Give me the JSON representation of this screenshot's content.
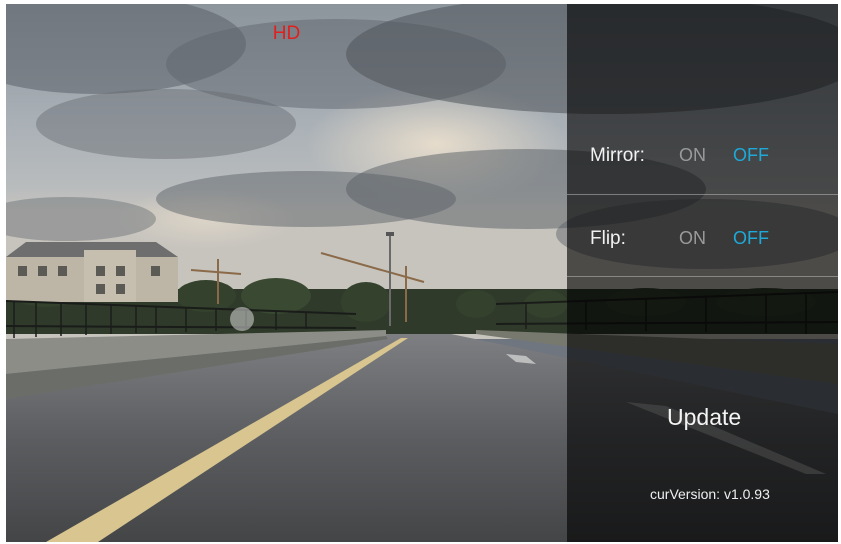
{
  "header": {
    "resolution_label": "HD",
    "resolution_color": "#e11f1f"
  },
  "settings": {
    "mirror": {
      "label": "Mirror:",
      "on_label": "ON",
      "off_label": "OFF",
      "selected": "OFF"
    },
    "flip": {
      "label": "Flip:",
      "on_label": "ON",
      "off_label": "OFF",
      "selected": "OFF"
    },
    "accent_color": "#1ea9d8",
    "inactive_color": "#9a9a9a"
  },
  "update": {
    "button_label": "Update"
  },
  "version": {
    "prefix": "curVersion:",
    "value": "v1.0.93"
  }
}
